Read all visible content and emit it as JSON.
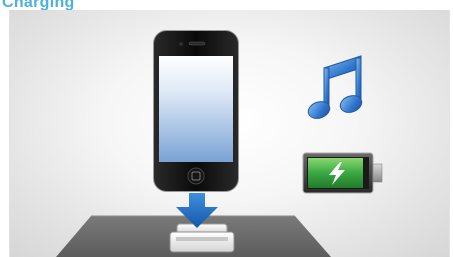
{
  "header": {
    "title": "Charging"
  },
  "illustration": {
    "icons": [
      "smartphone-icon",
      "down-arrow-icon",
      "dock-connector-icon",
      "music-note-icon",
      "battery-charging-icon"
    ],
    "colors": {
      "heading": "#4db0de",
      "arrow": "#1f6fc0",
      "music_note": "#2a71c9",
      "battery_fill": "#3aa843",
      "platform": "#6b6b6b",
      "phone_body": "#111111"
    }
  }
}
